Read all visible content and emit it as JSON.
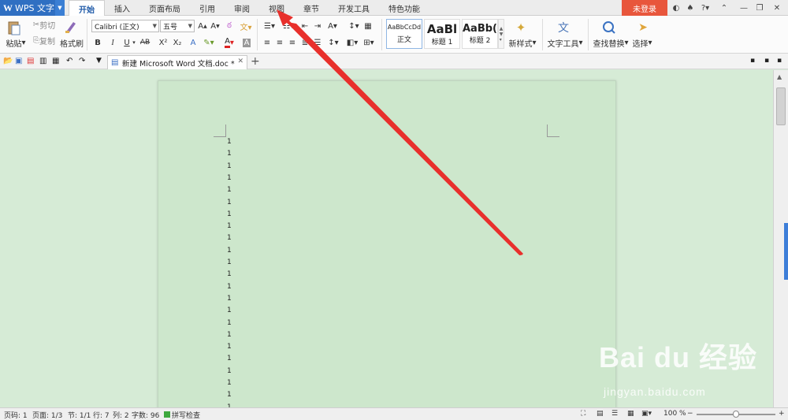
{
  "app": {
    "name": "WPS 文字",
    "logo": "W"
  },
  "tabs": [
    "开始",
    "插入",
    "页面布局",
    "引用",
    "审阅",
    "视图",
    "章节",
    "开发工具",
    "特色功能"
  ],
  "account": {
    "login_label": "未登录"
  },
  "ribbon": {
    "paste": "粘贴",
    "cut": "剪切",
    "copy": "复制",
    "format_painter": "格式刷",
    "font_name": "Calibri (正文)",
    "font_size": "五号",
    "bold": "B",
    "italic": "I",
    "underline": "U",
    "strike": "AB",
    "superscript": "X²",
    "subscript": "X₂",
    "styles": [
      {
        "preview": "AaBbCcDd",
        "name": "正文"
      },
      {
        "preview": "AaBl",
        "name": "标题 1"
      },
      {
        "preview": "AaBb(",
        "name": "标题 2"
      }
    ],
    "new_style": "新样式",
    "text_tools": "文字工具",
    "find_replace": "查找替换",
    "select": "选择"
  },
  "document": {
    "tab_title": "新建 Microsoft Word 文档.doc *",
    "lines": [
      "1",
      "1",
      "1",
      "1",
      "1",
      "1",
      "1",
      "1",
      "1",
      "1",
      "1",
      "1",
      "1",
      "1",
      "1",
      "1",
      "1",
      "1",
      "1",
      "1",
      "1",
      "1",
      "1"
    ]
  },
  "status": {
    "page_num": "页码: 1",
    "pages": "页面: 1/3",
    "section": "节: 1/1",
    "row": "行: 7",
    "col": "列: 2",
    "words": "字数: 96",
    "spell": "拼写检查",
    "zoom": "100 %"
  },
  "watermark": {
    "brand": "Bai du 经验",
    "url": "jingyan.baidu.com"
  },
  "colors": {
    "accent": "#2f6fc2",
    "login": "#e8563c",
    "page": "#cde7cc",
    "arrow": "#e8302c"
  }
}
